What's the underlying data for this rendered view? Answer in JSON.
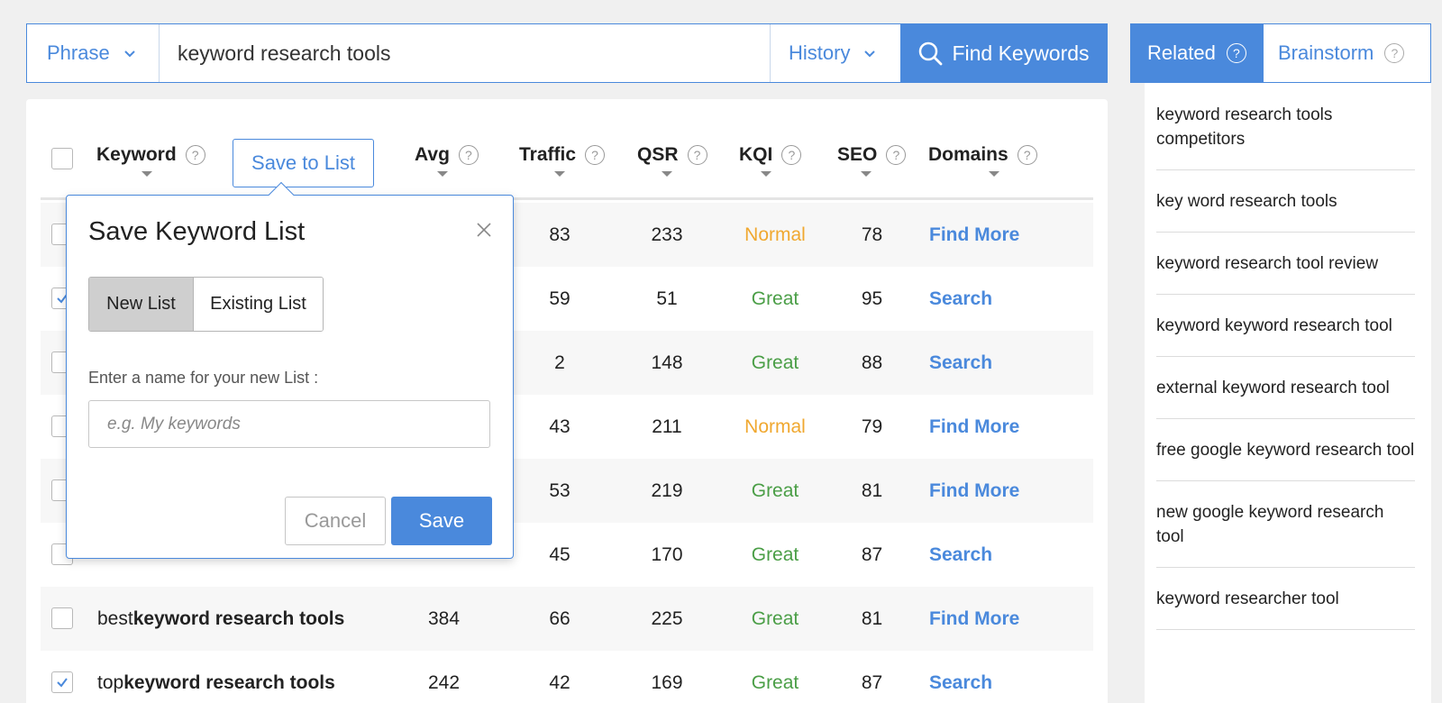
{
  "search": {
    "mode_label": "Phrase",
    "query": "keyword research tools",
    "history_label": "History",
    "find_label": "Find Keywords"
  },
  "table": {
    "headers": {
      "keyword": "Keyword",
      "avg": "Avg",
      "traffic": "Traffic",
      "qsr": "QSR",
      "kqi": "KQI",
      "seo": "SEO",
      "domains": "Domains"
    },
    "save_to_list_label": "Save to List",
    "rows": [
      {
        "prefix": "",
        "bold": "",
        "suffix": "",
        "avg": "",
        "traffic": "83",
        "qsr": "233",
        "kqi": "Normal",
        "seo": "78",
        "domains": "Find More",
        "checked": false
      },
      {
        "prefix": "",
        "bold": "",
        "suffix": "",
        "avg": "",
        "traffic": "59",
        "qsr": "51",
        "kqi": "Great",
        "seo": "95",
        "domains": "Search",
        "checked": true
      },
      {
        "prefix": "",
        "bold": "",
        "suffix": "",
        "avg": "",
        "traffic": "2",
        "qsr": "148",
        "kqi": "Great",
        "seo": "88",
        "domains": "Search",
        "checked": false
      },
      {
        "prefix": "",
        "bold": "",
        "suffix": "",
        "avg": "",
        "traffic": "43",
        "qsr": "211",
        "kqi": "Normal",
        "seo": "79",
        "domains": "Find More",
        "checked": false
      },
      {
        "prefix": "",
        "bold": "",
        "suffix": "",
        "avg": "",
        "traffic": "53",
        "qsr": "219",
        "kqi": "Great",
        "seo": "81",
        "domains": "Find More",
        "checked": false
      },
      {
        "prefix": "",
        "bold": "",
        "suffix": "",
        "avg": "",
        "traffic": "45",
        "qsr": "170",
        "kqi": "Great",
        "seo": "87",
        "domains": "Search",
        "checked": false
      },
      {
        "prefix": "best ",
        "bold": "keyword research tools",
        "suffix": "",
        "avg": "384",
        "traffic": "66",
        "qsr": "225",
        "kqi": "Great",
        "seo": "81",
        "domains": "Find More",
        "checked": false
      },
      {
        "prefix": "top ",
        "bold": "keyword research tools",
        "suffix": "",
        "avg": "242",
        "traffic": "42",
        "qsr": "169",
        "kqi": "Great",
        "seo": "87",
        "domains": "Search",
        "checked": true
      }
    ]
  },
  "popup": {
    "title": "Save Keyword List",
    "new_list_label": "New List",
    "existing_list_label": "Existing List",
    "name_label": "Enter a name for your new List :",
    "name_placeholder": "e.g. My keywords",
    "cancel_label": "Cancel",
    "save_label": "Save"
  },
  "sidebar": {
    "tabs": {
      "related": "Related",
      "brainstorm": "Brainstorm"
    },
    "items": [
      "keyword research tools competitors",
      "key word research tools",
      "keyword research tool review",
      "keyword keyword research tool",
      "external keyword research tool",
      "free google keyword research tool",
      "new google keyword research tool",
      "keyword researcher tool"
    ]
  },
  "colors": {
    "accent": "#4a89dc",
    "great": "#4a9e46",
    "normal": "#f0a830"
  }
}
